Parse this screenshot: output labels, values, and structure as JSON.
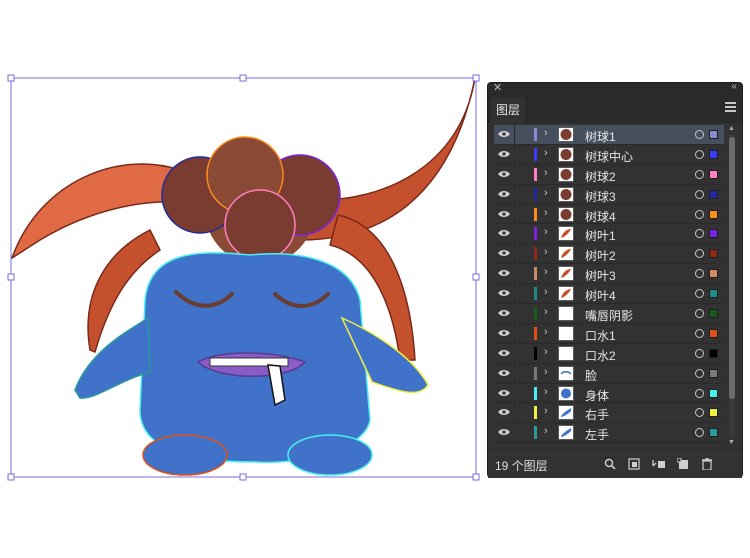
{
  "panel": {
    "title": "图层",
    "close_glyph": "✕",
    "collapse_glyph": "‹‹",
    "menu_icon": "hamburger-menu-icon",
    "layer_count": "19 个图层"
  },
  "layers": [
    {
      "name": "树球1",
      "color": "#8a8acf",
      "selected": true
    },
    {
      "name": "树球中心",
      "color": "#3c3cff"
    },
    {
      "name": "树球2",
      "color": "#ff7fbf"
    },
    {
      "name": "树球3",
      "color": "#1f2aa0"
    },
    {
      "name": "树球4",
      "color": "#ff8c1a"
    },
    {
      "name": "树叶1",
      "color": "#7a22e0"
    },
    {
      "name": "树叶2",
      "color": "#8b2a1a"
    },
    {
      "name": "树叶3",
      "color": "#d18a63"
    },
    {
      "name": "树叶4",
      "color": "#1f8a8a"
    },
    {
      "name": "嘴唇阴影",
      "color": "#1a5a1a"
    },
    {
      "name": "口水1",
      "color": "#e0501a"
    },
    {
      "name": "口水2",
      "color": "#000000"
    },
    {
      "name": "脸",
      "color": "#7a7a7a"
    },
    {
      "name": "身体",
      "color": "#4af0f0"
    },
    {
      "name": "右手",
      "color": "#f0f040"
    },
    {
      "name": "左手",
      "color": "#2a9a9a"
    }
  ],
  "footer_icons": [
    "search-icon",
    "collect-icon",
    "move-to-layer-icon",
    "new-sublayer-icon",
    "new-layer-icon",
    "delete-icon"
  ]
}
